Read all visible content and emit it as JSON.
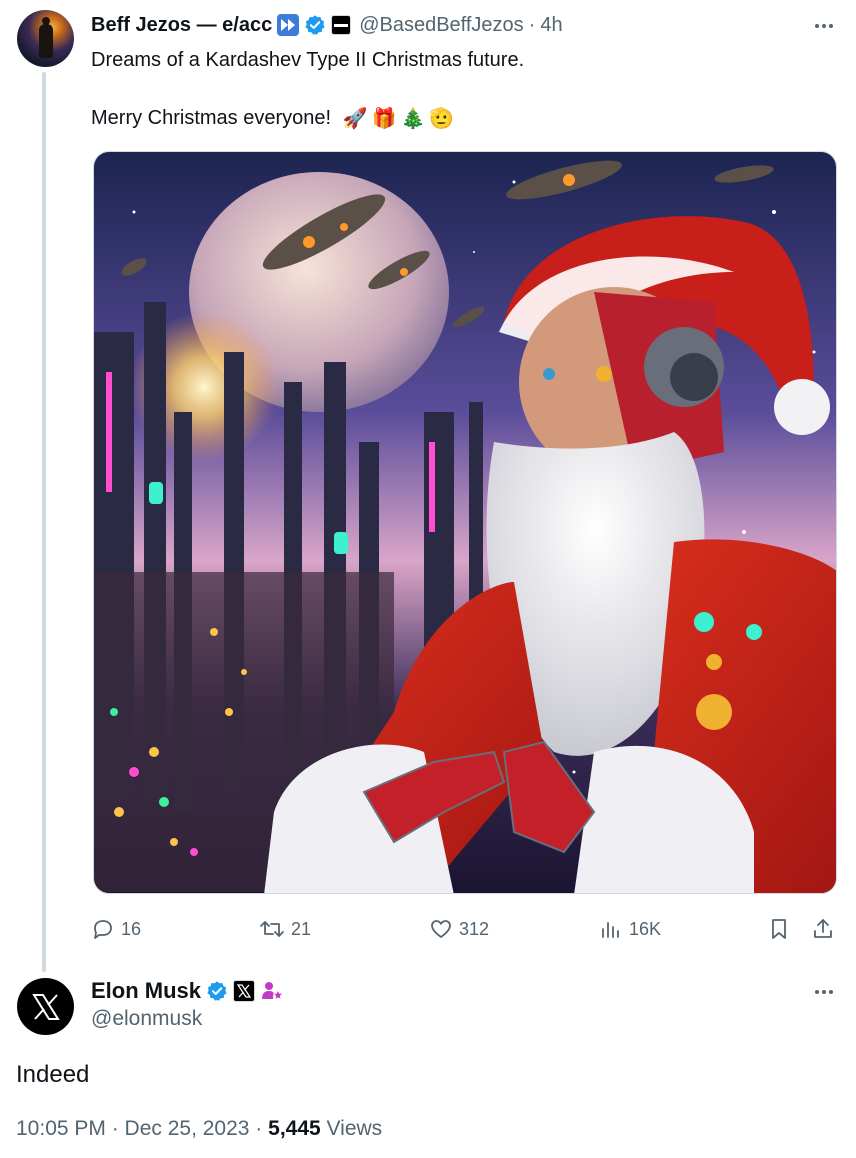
{
  "original_tweet": {
    "display_name": "Beff Jezos — e/acc",
    "handle": "@BasedBeffJezos",
    "separator": "·",
    "time_ago": "4h",
    "text_line1": "Dreams of a Kardashev Type II Christmas future.",
    "text_line2": "Merry Christmas everyone!",
    "emojis": [
      "🚀",
      "🎁",
      "🎄",
      "🫡"
    ],
    "stats": {
      "replies": "16",
      "reposts": "21",
      "likes": "312",
      "views": "16K"
    }
  },
  "reply": {
    "display_name": "Elon Musk",
    "handle": "@elonmusk",
    "text": "Indeed",
    "timestamp": "10:05 PM · Dec 25, 2023 · ",
    "view_count": "5,445",
    "views_label": " Views"
  },
  "colors": {
    "verified_blue": "#1d9bf0",
    "secondary_text": "#536471",
    "thread_line": "#cfd9de"
  }
}
